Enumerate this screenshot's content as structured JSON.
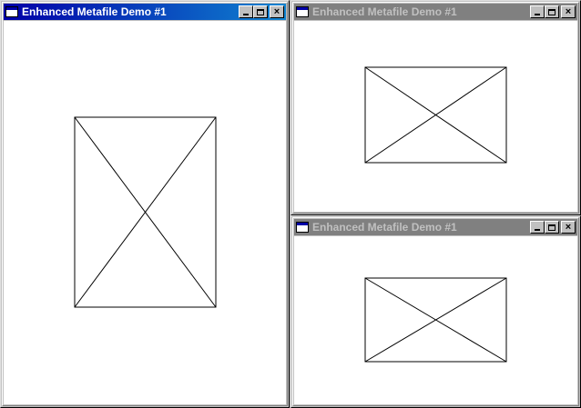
{
  "windows": [
    {
      "id": "win1",
      "title": "Enhanced Metafile Demo #1",
      "state": "active"
    },
    {
      "id": "win2",
      "title": "Enhanced Metafile Demo #1",
      "state": "inactive"
    },
    {
      "id": "win3",
      "title": "Enhanced Metafile Demo #1",
      "state": "inactive"
    }
  ],
  "controls": {
    "minimize": "_",
    "maximize": "□",
    "close": "×"
  },
  "icons": {
    "app": "window-app-icon",
    "minimize": "minimize-icon",
    "maximize": "maximize-icon",
    "close": "close-icon"
  }
}
